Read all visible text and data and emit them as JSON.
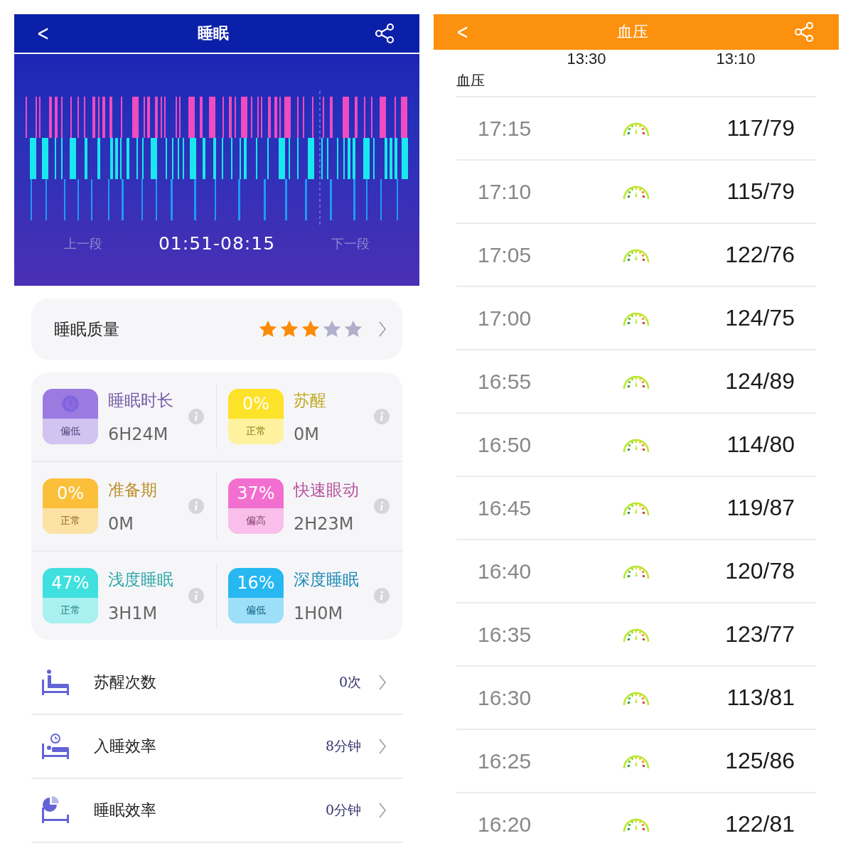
{
  "sleep": {
    "header": {
      "back": "<",
      "title": "睡眠"
    },
    "chart": {
      "prev": "上一段",
      "range": "01:51-08:15",
      "next": "下一段"
    },
    "quality": {
      "label": "睡眠质量",
      "stars": 3
    },
    "tiles": [
      {
        "kind": "icon",
        "color": "#9b7be0",
        "status": "偏低",
        "title": "睡眠时长",
        "value": "6H24M"
      },
      {
        "kind": "percent",
        "color": "#fde22a",
        "percent": "0%",
        "status": "正常",
        "title": "苏醒",
        "value": "0M"
      },
      {
        "kind": "percent",
        "color": "#fbbf3a",
        "percent": "0%",
        "status": "正常",
        "title": "准备期",
        "value": "0M"
      },
      {
        "kind": "percent",
        "color": "#f26fcf",
        "percent": "37%",
        "status": "偏高",
        "title": "快速眼动",
        "value": "2H23M"
      },
      {
        "kind": "percent",
        "color": "#3fe0de",
        "percent": "47%",
        "status": "正常",
        "title": "浅度睡眠",
        "value": "3H1M"
      },
      {
        "kind": "percent",
        "color": "#27b8f2",
        "percent": "16%",
        "status": "偏低",
        "title": "深度睡眠",
        "value": "1H0M"
      }
    ],
    "rows": [
      {
        "kind": "wake",
        "label": "苏醒次数",
        "value": "0次"
      },
      {
        "kind": "fall-asleep",
        "label": "入睡效率",
        "value": "8分钟"
      },
      {
        "kind": "efficiency",
        "label": "睡眠效率",
        "value": "0分钟"
      }
    ]
  },
  "pressure": {
    "header": {
      "back": "<",
      "title": "血压"
    },
    "top_times": [
      "13:30",
      "13:10"
    ],
    "section": "血压",
    "rows": [
      {
        "time": "17:15",
        "value": "117/79"
      },
      {
        "time": "17:10",
        "value": "115/79"
      },
      {
        "time": "17:05",
        "value": "122/76"
      },
      {
        "time": "17:00",
        "value": "124/75"
      },
      {
        "time": "16:55",
        "value": "124/89"
      },
      {
        "time": "16:50",
        "value": "114/80"
      },
      {
        "time": "16:45",
        "value": "119/87"
      },
      {
        "time": "16:40",
        "value": "120/78"
      },
      {
        "time": "16:35",
        "value": "123/77"
      },
      {
        "time": "16:30",
        "value": "113/81"
      },
      {
        "time": "16:25",
        "value": "125/86"
      },
      {
        "time": "16:20",
        "value": "122/81"
      }
    ]
  }
}
